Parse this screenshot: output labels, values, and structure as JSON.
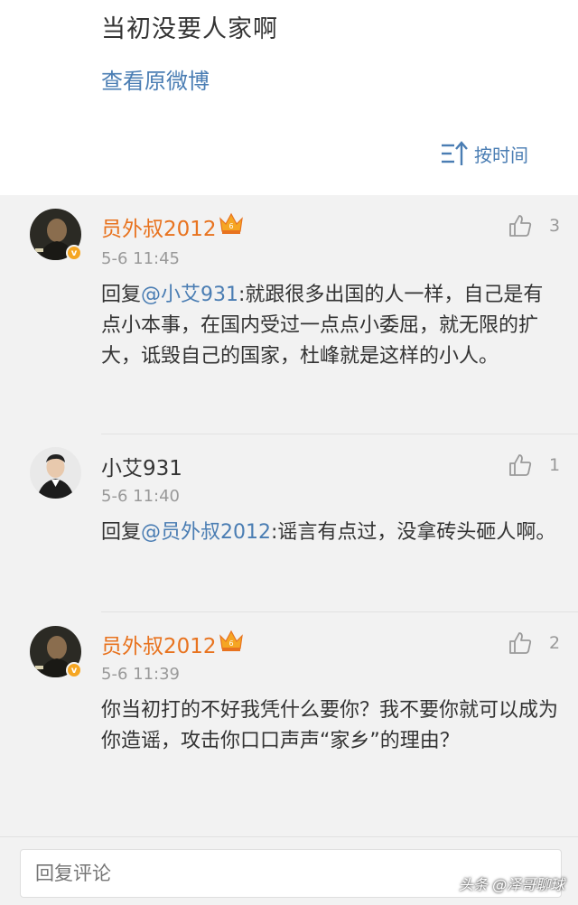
{
  "post": {
    "tail_text": "当初没要人家啊",
    "view_original_label": "查看原微博",
    "sort_label": "按时间"
  },
  "comments": [
    {
      "username": "员外叔2012",
      "user_type": "vip",
      "time": "5-6 11:45",
      "likes": "3",
      "reply_prefix": "回复",
      "mention": "@小艾931",
      "text": ":就跟很多出国的人一样，自己是有点小本事，在国内受过一点点小委屈，就无限的扩大，诋毁自己的国家，杜峰就是这样的小人。"
    },
    {
      "username": "小艾931",
      "user_type": "normal",
      "time": "5-6 11:40",
      "likes": "1",
      "reply_prefix": "回复",
      "mention": "@员外叔2012",
      "text": ":谣言有点过，没拿砖头砸人啊。"
    },
    {
      "username": "员外叔2012",
      "user_type": "vip",
      "time": "5-6 11:39",
      "likes": "2",
      "reply_prefix": "",
      "mention": "",
      "text": "你当初打的不好我凭什么要你？我不要你就可以成为你造谣，攻击你口口声声“家乡”的理由？"
    }
  ],
  "reply_bar": {
    "placeholder": "回复评论"
  },
  "watermark": "头条 @泽哥聊球",
  "colors": {
    "link": "#4a7db3",
    "vip_name": "#e8731f",
    "background": "#f2f2f2",
    "verified_badge": "#f5a623"
  }
}
